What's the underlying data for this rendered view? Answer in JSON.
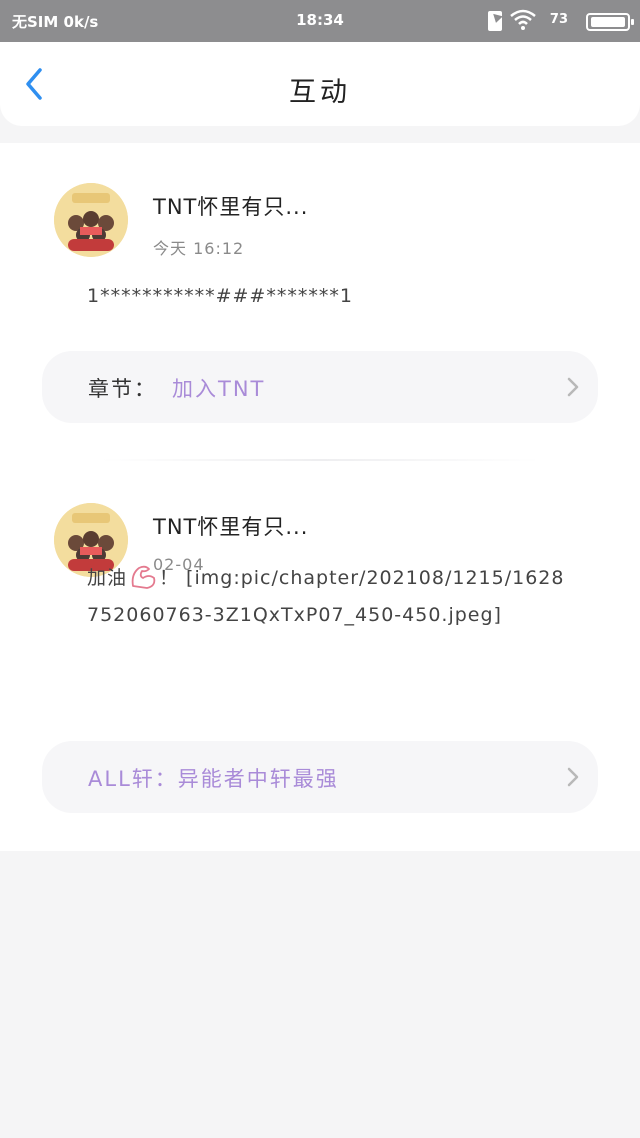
{
  "status_bar": {
    "carrier": "无SIM 0k/s",
    "time": "18:34",
    "battery_level": "73",
    "icons": [
      "charging-icon",
      "wifi-icon",
      "battery-icon"
    ]
  },
  "header": {
    "back_icon": "chevron-left-icon",
    "title": "互动"
  },
  "comments": [
    {
      "user_name": "TNT怀里有只...",
      "time": "今天 16:12",
      "text": "1***********###*******1",
      "chapter_label": "章节：",
      "chapter_title": "加入TNT"
    },
    {
      "user_name": "TNT怀里有只...",
      "time": "02-04",
      "text_prefix": "加油",
      "text_suffix": "！ [img:pic/chapter/202108/1215/1628752060763-3Z1QxTxP07_450-450.jpeg]",
      "chapter_title": "ALL轩：异能者中轩最强"
    }
  ],
  "colors": {
    "accent_blue": "#2f8ff0",
    "chapter_purple": "#a98bd8",
    "status_bar": "#8d8d8f",
    "background": "#f5f5f6"
  }
}
